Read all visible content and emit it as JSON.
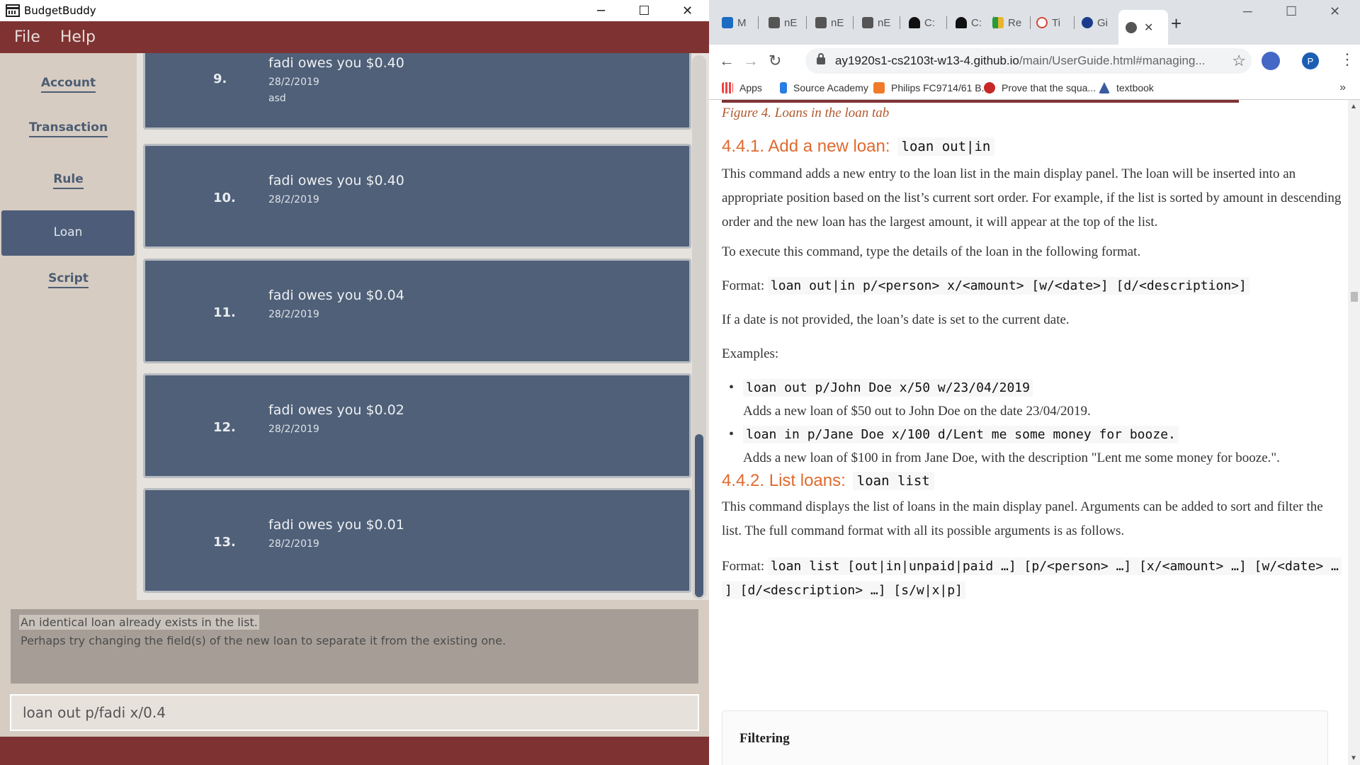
{
  "app": {
    "title": "BudgetBuddy",
    "menu": [
      "File",
      "Help"
    ],
    "sidebar": [
      {
        "label": "Account",
        "active": false
      },
      {
        "label": "Transaction",
        "active": false
      },
      {
        "label": "Rule",
        "active": false
      },
      {
        "label": "Loan",
        "active": true
      },
      {
        "label": "Script",
        "active": false
      }
    ],
    "loans": [
      {
        "num": "9.",
        "title": "fadi owes you $0.40",
        "date": "28/2/2019",
        "desc": "asd"
      },
      {
        "num": "10.",
        "title": "fadi owes you $0.40",
        "date": "28/2/2019",
        "desc": ""
      },
      {
        "num": "11.",
        "title": "fadi owes you $0.04",
        "date": "28/2/2019",
        "desc": ""
      },
      {
        "num": "12.",
        "title": "fadi owes you $0.02",
        "date": "28/2/2019",
        "desc": ""
      },
      {
        "num": "13.",
        "title": "fadi owes you $0.01",
        "date": "28/2/2019",
        "desc": ""
      }
    ],
    "result": {
      "line1": "An identical loan already exists in the list.",
      "line2": "Perhaps try changing the field(s) of the new loan to separate it from the existing one."
    },
    "command": "loan out p/fadi x/0.4",
    "colors": {
      "header": "#7e3332",
      "card": "#4f6078",
      "active_tab": "#4d5d79"
    }
  },
  "browser": {
    "tabs": [
      {
        "label": "M",
        "icon": "outlook-icon",
        "color": "#1c6bc2"
      },
      {
        "label": "nE",
        "icon": "notion-icon",
        "color": "#555"
      },
      {
        "label": "nE",
        "icon": "notion-icon",
        "color": "#555"
      },
      {
        "label": "nE",
        "icon": "notion-icon",
        "color": "#555"
      },
      {
        "label": "C:",
        "icon": "graduation-cap-icon",
        "color": "#111"
      },
      {
        "label": "C:",
        "icon": "graduation-cap-icon",
        "color": "#111"
      },
      {
        "label": "Re",
        "icon": "grid-icon",
        "color": "#2a9a3a"
      },
      {
        "label": "Ti",
        "icon": "gmail-icon",
        "color": "#d44638"
      },
      {
        "label": "Gi",
        "icon": "circle-icon",
        "color": "#1b3c8c"
      },
      {
        "label": "",
        "icon": "globe-icon",
        "color": "#555",
        "active": true
      }
    ],
    "url_host": "ay1920s1-cs2103t-w13-4.github.io",
    "url_path": "/main/UserGuide.html#managing...",
    "profile_initial": "P",
    "bookmarks": [
      {
        "label": "Apps",
        "icon": "apps-icon",
        "color": "#e44"
      },
      {
        "label": "Source Academy",
        "icon": "source-academy-icon",
        "color": "#2a7de1"
      },
      {
        "label": "Philips FC9714/61 B...",
        "icon": "philips-icon",
        "color": "#f07a2a"
      },
      {
        "label": "Prove that the squa...",
        "icon": "gear-red-icon",
        "color": "#c62828"
      },
      {
        "label": "textbook",
        "icon": "sailboat-icon",
        "color": "#3a5ba0"
      }
    ],
    "doc": {
      "figure_caption": "Figure 4. Loans in the loan tab",
      "h_add": "4.4.1. Add a new loan:",
      "h_add_code": "loan out|in",
      "p_add": "This command adds a new entry to the loan list in the main display panel. The loan will be inserted into an appropriate position based on the list’s current sort order. For example, if the list is sorted by amount in descending order and the new loan has the largest amount, it will appear at the top of the list.",
      "p_exec": "To execute this command, type the details of the loan in the following format.",
      "format_label": "Format:",
      "format_add": "loan out|in p/<person> x/<amount> [w/<date>] [d/<description>]",
      "p_date": "If a date is not provided, the loan’s date is set to the current date.",
      "examples_label": "Examples:",
      "ex1_code": "loan out p/John Doe x/50 w/23/04/2019",
      "ex1_text": "Adds a new loan of $50 out to John Doe on the date 23/04/2019.",
      "ex2_code": "loan in p/Jane Doe x/100 d/Lent me some money for booze.",
      "ex2_text": "Adds a new loan of $100 in from Jane Doe, with the description \"Lent me some money for booze.\".",
      "h_list": "4.4.2. List loans:",
      "h_list_code": "loan list",
      "p_list": "This command displays the list of loans in the main display panel. Arguments can be added to sort and filter the list. The full command format with all its possible arguments is as follows.",
      "format_list_1": "loan list [out|in|unpaid|paid …] [p/<person> …] [x/<amount> …] [w/<date> …",
      "format_list_2": "] [d/<description> …] [s/w|x|p]",
      "filter_title": "Filtering"
    }
  }
}
